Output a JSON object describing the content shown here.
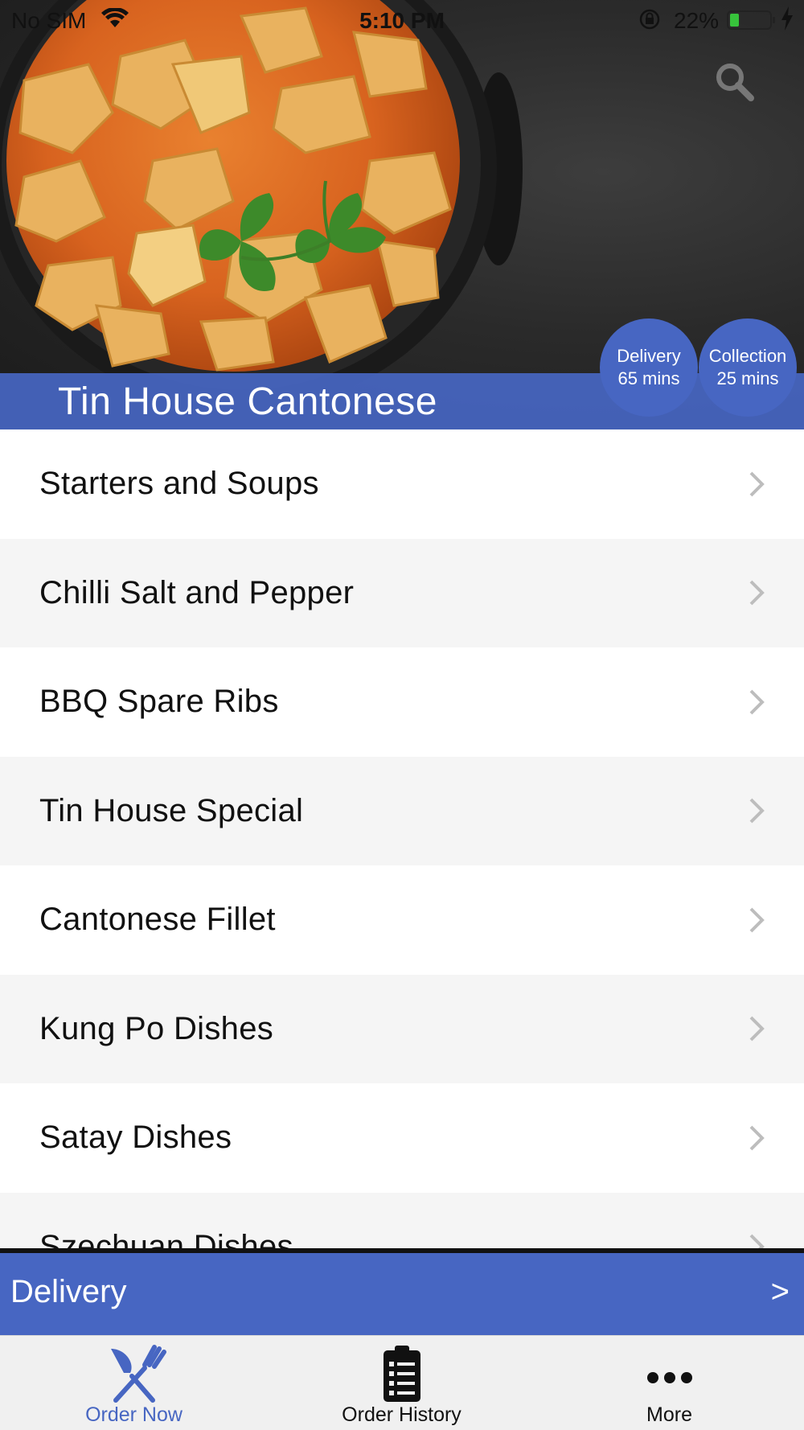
{
  "status_bar": {
    "carrier": "No SIM",
    "time": "5:10 PM",
    "battery_percent_label": "22%",
    "battery_level": 0.22
  },
  "header": {
    "restaurant_name": "Tin House Cantonese",
    "search_icon": "search-icon"
  },
  "badges": {
    "delivery": {
      "label": "Delivery",
      "value": "65 mins"
    },
    "collection": {
      "label": "Collection",
      "value": "25 mins"
    }
  },
  "menu": {
    "items": [
      {
        "label": "Starters and Soups"
      },
      {
        "label": "Chilli Salt and Pepper"
      },
      {
        "label": "BBQ Spare Ribs"
      },
      {
        "label": "Tin House Special"
      },
      {
        "label": "Cantonese Fillet"
      },
      {
        "label": "Kung Po Dishes"
      },
      {
        "label": "Satay Dishes"
      },
      {
        "label": "Szechuan Dishes"
      }
    ]
  },
  "order_mode_bar": {
    "label": "Delivery",
    "arrow": ">"
  },
  "tabs": [
    {
      "label": "Order Now",
      "icon": "fork-knife-icon",
      "active": true
    },
    {
      "label": "Order History",
      "icon": "clipboard-list-icon",
      "active": false
    },
    {
      "label": "More",
      "icon": "more-dots-icon",
      "active": false
    }
  ],
  "colors": {
    "accent": "#4766c2",
    "row_alt": "#f5f5f5",
    "battery_green": "#37c23b"
  }
}
